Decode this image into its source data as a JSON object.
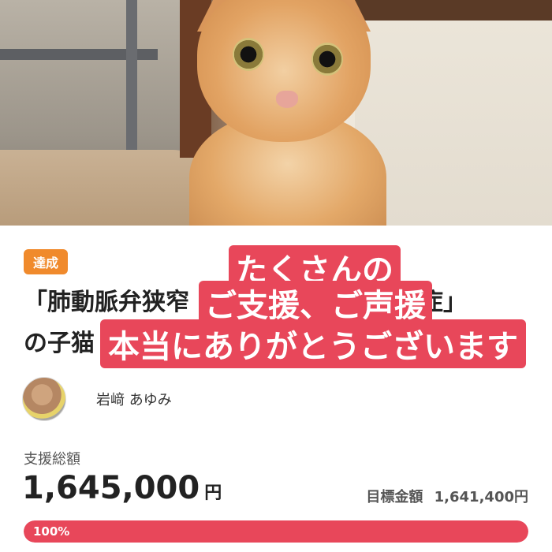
{
  "project": {
    "status_badge": "達成",
    "title_line1": "「肺動脈弁狭窄",
    "title_line1_end": "数症」",
    "title_line2": "の子猫"
  },
  "overlay_captions": [
    "たくさんの",
    "ご支援、ご声援",
    "本当にありがとうございます"
  ],
  "author": {
    "name": "岩﨑 あゆみ"
  },
  "funding": {
    "total_label": "支援総額",
    "total_amount": "1,645,000",
    "currency": "円",
    "target_label": "目標金額",
    "target_amount": "1,641,400円",
    "progress_text": "100%",
    "progress_value": 1.0
  },
  "colors": {
    "accent": "#e8475a",
    "badge": "#f08a2c"
  }
}
